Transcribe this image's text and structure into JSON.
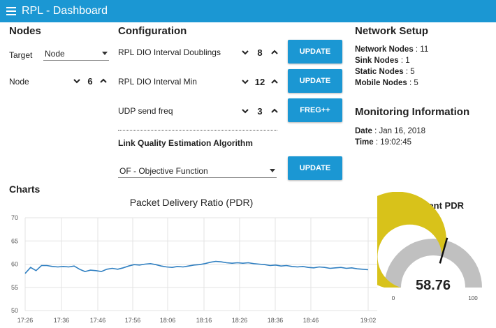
{
  "header": {
    "title": "RPL - Dashboard"
  },
  "nodes": {
    "heading": "Nodes",
    "target_label": "Target",
    "target_value": "Node",
    "node_label": "Node",
    "node_value": "6"
  },
  "configuration": {
    "heading": "Configuration",
    "rows": [
      {
        "label": "RPL DIO Interval Doublings",
        "value": "8",
        "button": "UPDATE"
      },
      {
        "label": "RPL DIO Interval Min",
        "value": "12",
        "button": "UPDATE"
      },
      {
        "label": "UDP send freq",
        "value": "3",
        "button": "FREG++"
      }
    ],
    "lqe_heading": "Link Quality Estimation Algorithm",
    "of_value": "OF - Objective Function",
    "of_button": "UPDATE"
  },
  "network": {
    "heading": "Network Setup",
    "lines": [
      {
        "label": "Network Nodes",
        "value": " : 11"
      },
      {
        "label": "Sink Nodes",
        "value": " : 1"
      },
      {
        "label": "Static Nodes",
        "value": " : 5"
      },
      {
        "label": "Mobile Nodes",
        "value": " : 5"
      }
    ]
  },
  "monitoring": {
    "heading": "Monitoring Information",
    "date_label": "Date",
    "date_value": " : Jan 16, 2018",
    "time_label": "Time",
    "time_value": " : 19:02:45"
  },
  "charts": {
    "heading": "Charts"
  },
  "chart_data": [
    {
      "type": "line",
      "title": "Packet Delivery Ratio (PDR)",
      "xlabel": "",
      "ylabel": "",
      "ylim": [
        50,
        70
      ],
      "y_ticks": [
        50,
        55,
        60,
        65,
        70
      ],
      "x_tick_labels": [
        "17:26",
        "17:36",
        "17:46",
        "17:56",
        "18:06",
        "18:16",
        "18:26",
        "18:36",
        "18:46",
        "19:02"
      ],
      "grid": true,
      "series": [
        {
          "values": [
            58.0,
            59.3,
            58.6,
            59.7,
            59.7,
            59.5,
            59.4,
            59.5,
            59.4,
            59.6,
            58.9,
            58.4,
            58.7,
            58.6,
            58.4,
            58.9,
            59.1,
            58.9,
            59.2,
            59.6,
            59.9,
            59.8,
            60.0,
            60.1,
            59.9,
            59.6,
            59.4,
            59.3,
            59.5,
            59.4,
            59.6,
            59.8,
            59.9,
            60.1,
            60.4,
            60.6,
            60.5,
            60.3,
            60.2,
            60.3,
            60.2,
            60.3,
            60.1,
            60.0,
            59.9,
            59.7,
            59.8,
            59.6,
            59.7,
            59.5,
            59.4,
            59.5,
            59.3,
            59.2,
            59.4,
            59.3,
            59.1,
            59.2,
            59.3,
            59.1,
            59.2,
            59.0,
            58.9,
            58.8
          ]
        }
      ],
      "colors": {
        "line": "#2f7fc1",
        "grid": "#e3e3e3"
      }
    },
    {
      "type": "gauge",
      "title": "Current PDR",
      "value": 58.76,
      "min": 0,
      "max": 100,
      "min_label": "0",
      "max_label": "100",
      "colors": {
        "fill": "#d8c21a",
        "track": "#c0c0c0"
      }
    }
  ]
}
